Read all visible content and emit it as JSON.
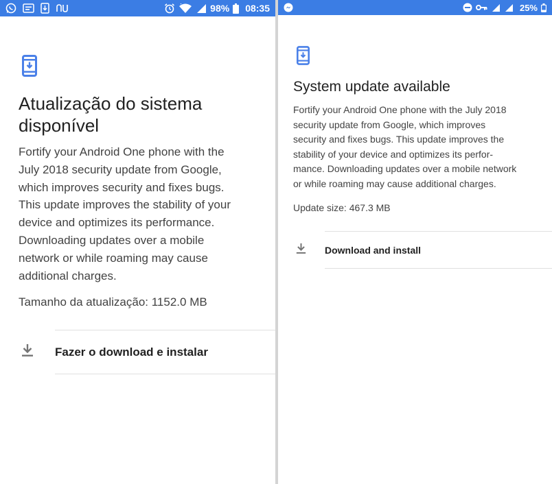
{
  "left": {
    "status": {
      "battery": "98%",
      "time": "08:35"
    },
    "title": "Atualização do sistema disponível",
    "body_lines": [
      "Fortify your Android One phone with the",
      "July 2018 security update from Google,",
      "which improves security and fixes bugs.",
      "This update improves the stability of your",
      "device and optimizes its performance.",
      "Downloading updates over a mobile",
      "network or while roaming may cause",
      "additional charges."
    ],
    "update_size": "Tamanho da atualização: 1152.0 MB",
    "action_label": "Fazer o download e instalar",
    "icons": [
      "whatsapp-icon",
      "message-icon",
      "download-notif-icon",
      "nu-icon",
      "alarm-icon",
      "wifi-icon",
      "signal-icon",
      "battery-icon",
      "phone-update-icon",
      "download-icon"
    ]
  },
  "right": {
    "status": {
      "battery": "25%"
    },
    "title": "System update available",
    "body_lines": [
      "Fortify your Android One phone with the July 2018",
      "security update from Google, which improves",
      "security and fixes bugs. This update improves the",
      "stability of your device and optimizes its perfor-",
      "mance. Downloading updates over a mobile network",
      "or while roaming may cause additional charges."
    ],
    "update_size": "Update size: 467.3 MB",
    "action_label": "Download and install",
    "icons": [
      "messenger-icon",
      "dnd-icon",
      "vpn-key-icon",
      "signal-icon",
      "battery-icon",
      "phone-update-icon",
      "download-icon"
    ]
  },
  "colors": {
    "statusbar": "#3b7de4",
    "accent_icon": "#4a80e8",
    "text_primary": "#212121",
    "text_secondary": "#424242",
    "divider": "#e0e0e0"
  }
}
